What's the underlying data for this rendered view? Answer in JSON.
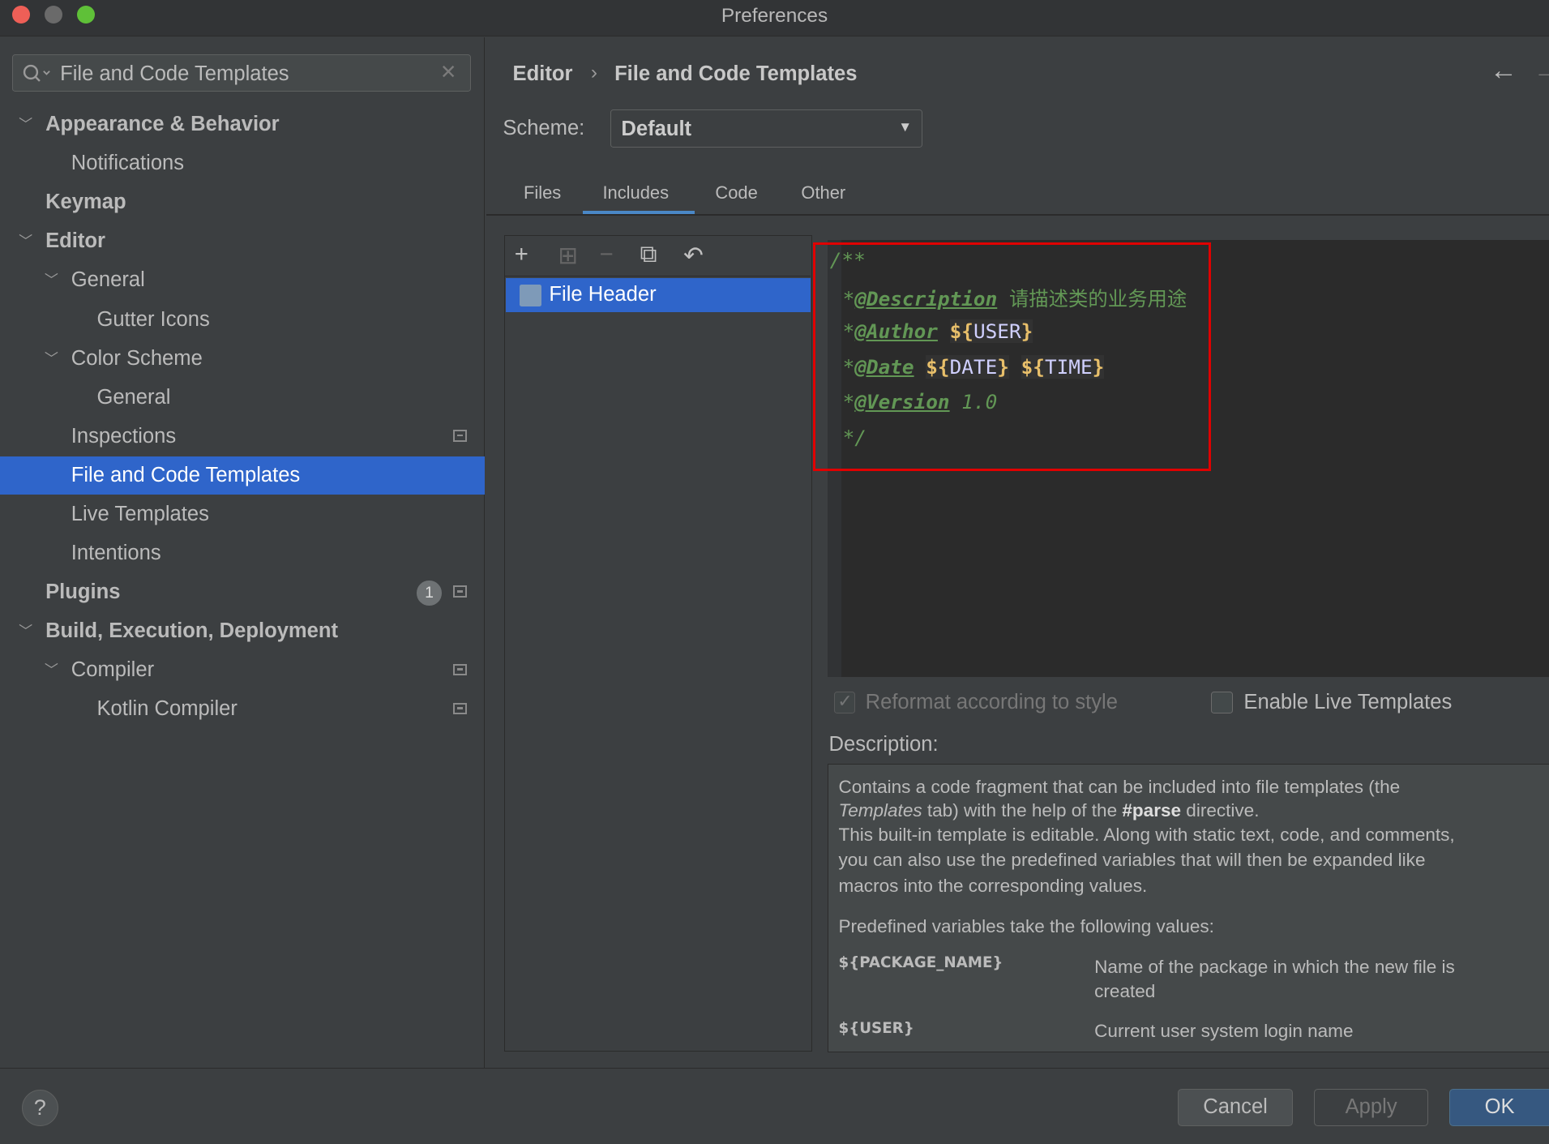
{
  "window": {
    "title": "Preferences"
  },
  "search": {
    "value": "File and Code Templates"
  },
  "tree": [
    {
      "label": "Appearance & Behavior",
      "level": 0,
      "bold": true,
      "chev": true
    },
    {
      "label": "Notifications",
      "level": 1
    },
    {
      "label": "Keymap",
      "level": 0,
      "bold": true
    },
    {
      "label": "Editor",
      "level": 0,
      "bold": true,
      "chev": true
    },
    {
      "label": "General",
      "level": 1,
      "chev": true
    },
    {
      "label": "Gutter Icons",
      "level": 2
    },
    {
      "label": "Color Scheme",
      "level": 1,
      "chev": true
    },
    {
      "label": "General",
      "level": 2
    },
    {
      "label": "Inspections",
      "level": 1,
      "mini": true
    },
    {
      "label": "File and Code Templates",
      "level": 1,
      "selected": true
    },
    {
      "label": "Live Templates",
      "level": 1
    },
    {
      "label": "Intentions",
      "level": 1
    },
    {
      "label": "Plugins",
      "level": 0,
      "bold": true,
      "badge": "1",
      "mini": true
    },
    {
      "label": "Build, Execution, Deployment",
      "level": 0,
      "bold": true,
      "chev": true
    },
    {
      "label": "Compiler",
      "level": 1,
      "chev": true,
      "mini": true
    },
    {
      "label": "Kotlin Compiler",
      "level": 2,
      "mini": true
    }
  ],
  "breadcrumb": {
    "parent": "Editor",
    "current": "File and Code Templates"
  },
  "scheme": {
    "label": "Scheme:",
    "value": "Default"
  },
  "tabs": [
    {
      "label": "Files"
    },
    {
      "label": "Includes",
      "selected": true
    },
    {
      "label": "Code"
    },
    {
      "label": "Other"
    }
  ],
  "templates": {
    "items": [
      "File Header"
    ],
    "selected": "File Header"
  },
  "code": {
    "l1": "/**",
    "l2_tag": "@Description",
    "l2_text": "请描述类的业务用途",
    "l3_tag": "@Author",
    "l3_var": "USER",
    "l4_tag": "@Date",
    "l4_var1": "DATE",
    "l4_var2": "TIME",
    "l5_tag": "@Version",
    "l5_text": "1.0",
    "l6": "*/"
  },
  "options": {
    "reformat": {
      "label": "Reformat according to style",
      "checked": true,
      "disabled": true
    },
    "live": {
      "label": "Enable Live Templates",
      "checked": false
    }
  },
  "description": {
    "label": "Description:",
    "p1a": "Contains a code fragment that can be included into file templates (the",
    "p1b_em": "Templates",
    "p1b_mid": " tab) with the help of the ",
    "p1b_bold": "#parse",
    "p1b_end": " directive.",
    "p2a": "This built-in template is editable. Along with static text, code, and comments,",
    "p2b": "you can also use the predefined variables that will then be expanded like",
    "p2c": "macros into the corresponding values.",
    "p3": "Predefined variables take the following values:",
    "vars": [
      {
        "name": "${PACKAGE_NAME}",
        "desc1": "Name of the package in which the new file is",
        "desc2": "created"
      },
      {
        "name": "${USER}",
        "desc1": "Current user system login name"
      }
    ]
  },
  "footer": {
    "help": "?",
    "cancel": "Cancel",
    "apply": "Apply",
    "ok": "OK"
  },
  "colors": {
    "selection": "#2f65ca",
    "accent": "#4a88c7",
    "highlight_box": "#e00000"
  }
}
